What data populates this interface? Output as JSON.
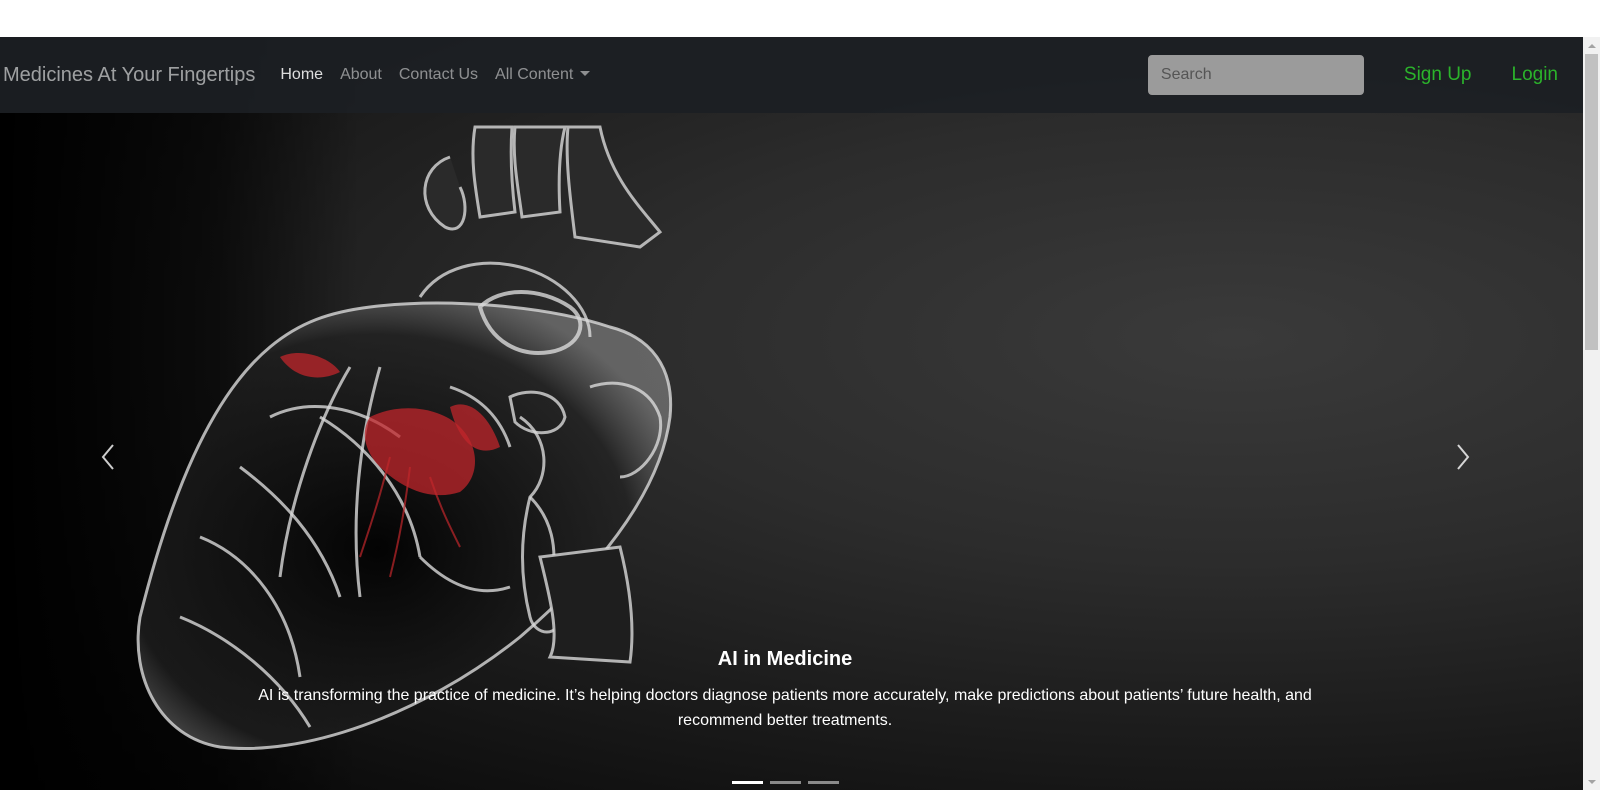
{
  "navbar": {
    "brand": "Medicines At Your Fingertips",
    "links": [
      {
        "label": "Home",
        "active": true
      },
      {
        "label": "About",
        "active": false
      },
      {
        "label": "Contact Us",
        "active": false
      },
      {
        "label": "All Content",
        "active": false,
        "dropdown": true
      }
    ],
    "search": {
      "placeholder": "Search",
      "value": ""
    },
    "signup_label": "Sign Up",
    "login_label": "Login",
    "auth_color": "#2bb32b"
  },
  "carousel": {
    "slide": {
      "image": "transparent-heart-illustration",
      "caption_title": "AI in Medicine",
      "caption_text": "AI is transforming the practice of medicine. It’s helping doctors diagnose patients more accurately, make predictions about patients’ future health, and recommend better treatments."
    },
    "prev_icon": "chevron-left-icon",
    "next_icon": "chevron-right-icon",
    "slide_count": 3,
    "active_index": 0
  }
}
